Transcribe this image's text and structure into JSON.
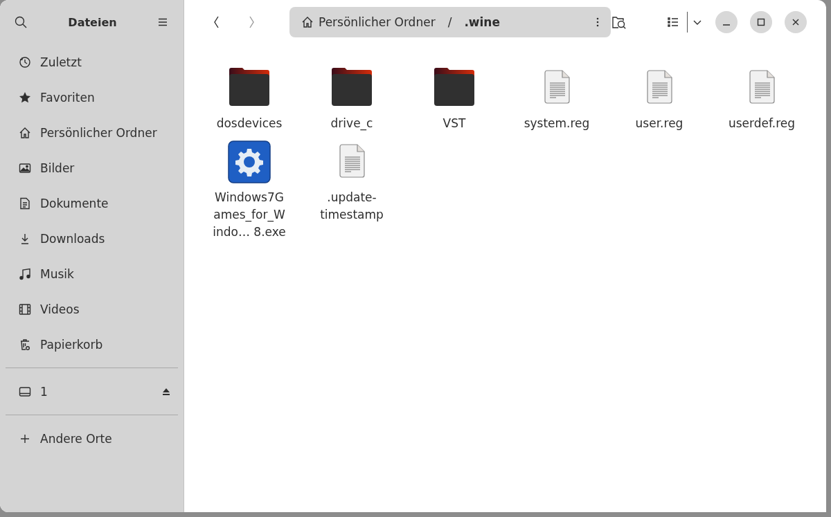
{
  "sidebar": {
    "title": "Dateien",
    "places": [
      {
        "label": "Zuletzt"
      },
      {
        "label": "Favoriten"
      },
      {
        "label": "Persönlicher Ordner"
      },
      {
        "label": "Bilder"
      },
      {
        "label": "Dokumente"
      },
      {
        "label": "Downloads"
      },
      {
        "label": "Musik"
      },
      {
        "label": "Videos"
      },
      {
        "label": "Papierkorb"
      }
    ],
    "devices": [
      {
        "label": "1",
        "ejectable": true
      }
    ],
    "other": {
      "label": "Andere Orte"
    }
  },
  "path_bar": {
    "segments": [
      "Persönlicher Ordner",
      ".wine"
    ],
    "separator": "/"
  },
  "files": [
    {
      "kind": "folder",
      "label_lines": [
        "dosdevices"
      ]
    },
    {
      "kind": "folder",
      "label_lines": [
        "drive_c"
      ]
    },
    {
      "kind": "folder",
      "label_lines": [
        "VST"
      ]
    },
    {
      "kind": "document",
      "label_lines": [
        "system.reg"
      ]
    },
    {
      "kind": "document",
      "label_lines": [
        "user.reg"
      ]
    },
    {
      "kind": "document",
      "label_lines": [
        "userdef.reg"
      ]
    },
    {
      "kind": "executable",
      "label_lines": [
        "Windows7G",
        "ames_for_W",
        "indo… 8.exe"
      ]
    },
    {
      "kind": "document",
      "label_lines": [
        ".update-",
        "timestamp"
      ]
    }
  ]
}
